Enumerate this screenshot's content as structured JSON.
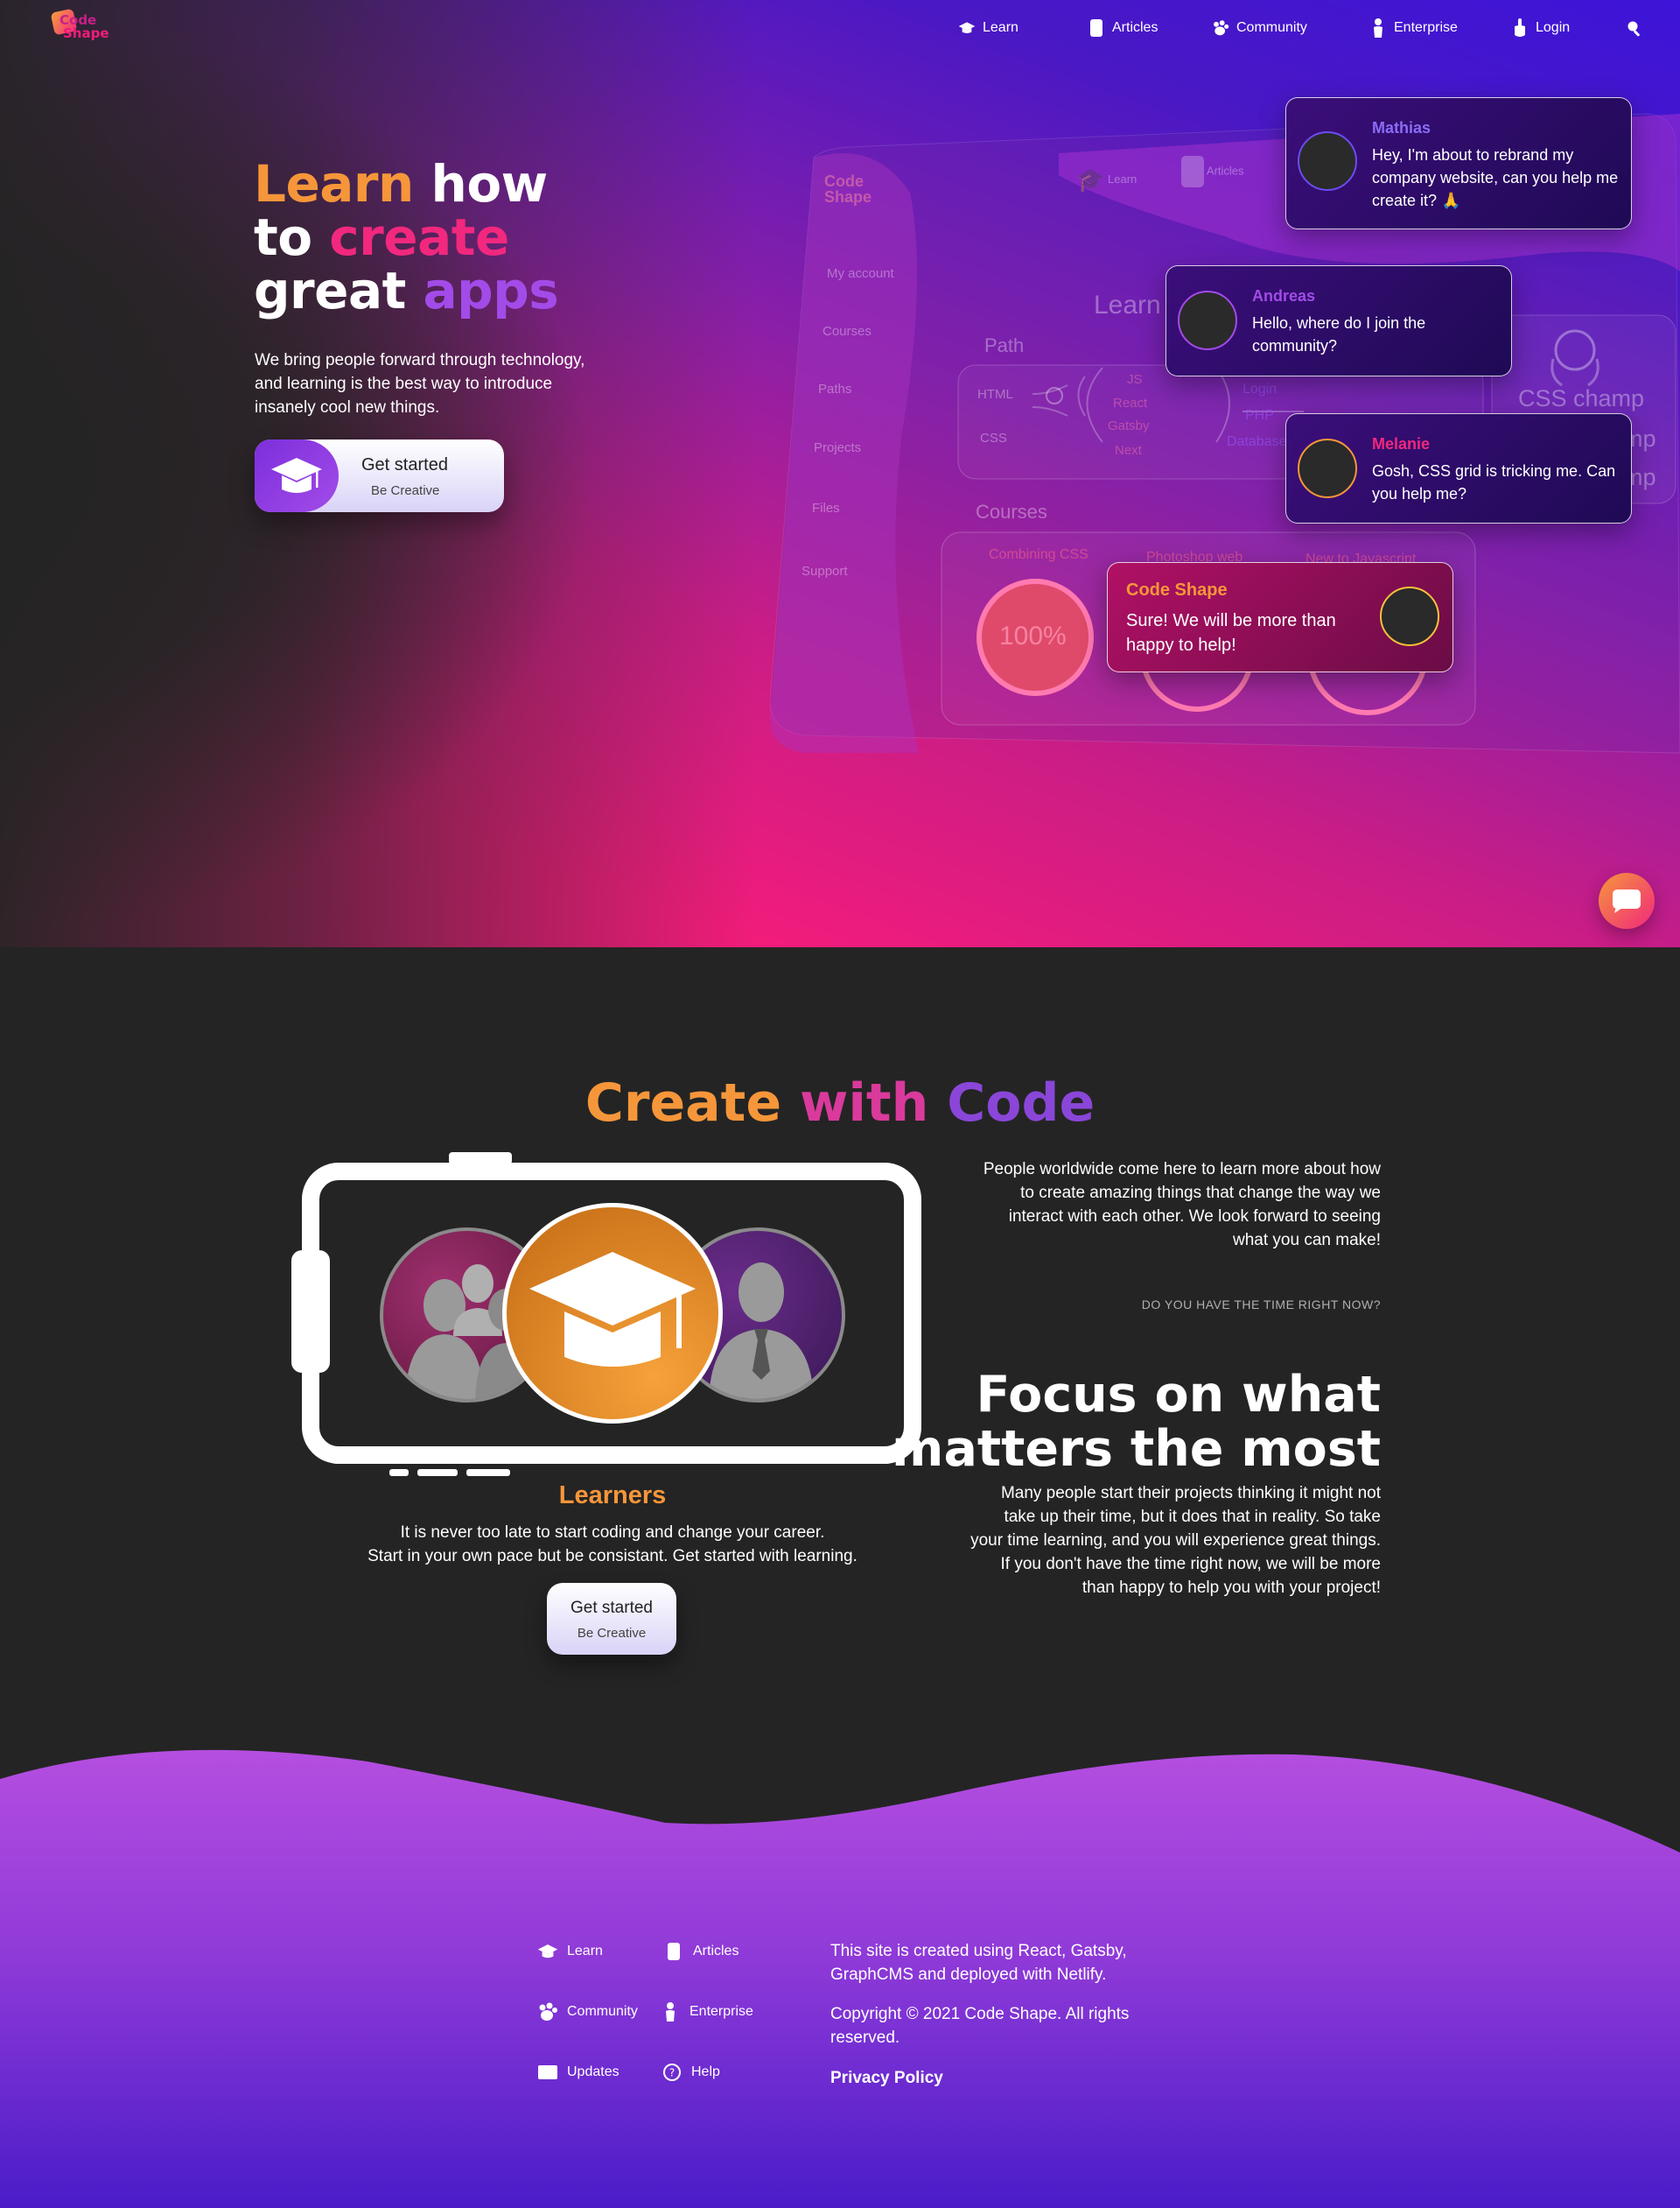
{
  "nav": {
    "logo": {
      "line1": "Code",
      "line2": "Shape"
    },
    "items": [
      {
        "label": "Learn",
        "icon": "graduation-cap-icon"
      },
      {
        "label": "Articles",
        "icon": "document-icon"
      },
      {
        "label": "Community",
        "icon": "paw-icon"
      },
      {
        "label": "Enterprise",
        "icon": "person-icon"
      },
      {
        "label": "Login",
        "icon": "hand-icon"
      }
    ],
    "search_icon": "search-icon"
  },
  "hero": {
    "title": {
      "w1": "Learn",
      "w2": "how",
      "w3": "to",
      "w4": "create",
      "w5": "great",
      "w6": "apps"
    },
    "description": "We bring people forward through technology, and learning is the best way to introduce insanely cool new things.",
    "cta": {
      "label": "Get started",
      "sublabel": "Be Creative"
    }
  },
  "mockup": {
    "logo": {
      "line1": "Code",
      "line2": "Shape"
    },
    "sidebar": [
      "My account",
      "Courses",
      "Paths",
      "Projects",
      "Files",
      "Support"
    ],
    "topnav": [
      "Learn",
      "Articles"
    ],
    "learn_heading": "Learn",
    "path_heading": "Path",
    "path_left": [
      "HTML",
      "CSS"
    ],
    "path_mid": [
      "JS",
      "React",
      "Gatsby",
      "Next"
    ],
    "path_right": [
      "Login",
      "PHP",
      "Database"
    ],
    "champ": [
      "CSS champ",
      "mp",
      "mp"
    ],
    "courses_heading": "Courses",
    "courses": [
      "Combining CSS",
      "Photoshop web",
      "New to Javascript"
    ],
    "progress": "100%"
  },
  "chats": [
    {
      "name": "Mathias",
      "message": "Hey, I'm about to rebrand my company website, can you help me create it? 🙏"
    },
    {
      "name": "Andreas",
      "message": "Hello, where do I join the community?"
    },
    {
      "name": "Melanie",
      "message": "Gosh, CSS grid is tricking me. Can you help me?"
    },
    {
      "name": "Code Shape",
      "message": "Sure! We will be more than happy to help!"
    }
  ],
  "section2": {
    "title": {
      "w1": "Create",
      "w2": "with",
      "w3": "Code"
    },
    "learners": {
      "title": "Learners",
      "line1": "It is never too late to start coding and change your career.",
      "line2": "Start in your own pace but be consistant. Get started with learning.",
      "cta": {
        "label": "Get started",
        "sublabel": "Be Creative"
      }
    },
    "intro": "People worldwide come here to learn more about how to create amazing things that change the way we interact with each other. We look forward to seeing what you can make!",
    "caption": "DO YOU HAVE THE TIME RIGHT NOW?",
    "focus_title_1": "Focus on what",
    "focus_title_2": "matters the most",
    "focus_text": "Many people start their projects thinking it might not take up their time, but it does that in reality. So take your time learning, and you will experience great things. If you don't have the time right now, we will be more than happy to help you with your project!"
  },
  "footer": {
    "links": [
      {
        "label": "Learn",
        "icon": "graduation-cap-icon"
      },
      {
        "label": "Articles",
        "icon": "document-icon"
      },
      {
        "label": "Community",
        "icon": "paw-icon"
      },
      {
        "label": "Enterprise",
        "icon": "person-icon"
      },
      {
        "label": "Updates",
        "icon": "window-icon"
      },
      {
        "label": "Help",
        "icon": "help-icon"
      }
    ],
    "about": "This site is created using React, Gatsby, GraphCMS and deployed with Netlify.",
    "copyright": "Copyright © 2021 Code Shape. All rights reserved.",
    "privacy": "Privacy Policy"
  },
  "colors": {
    "orange": "#f6963a",
    "pink": "#f1287e",
    "purple": "#a24be8",
    "background": "#242424"
  }
}
